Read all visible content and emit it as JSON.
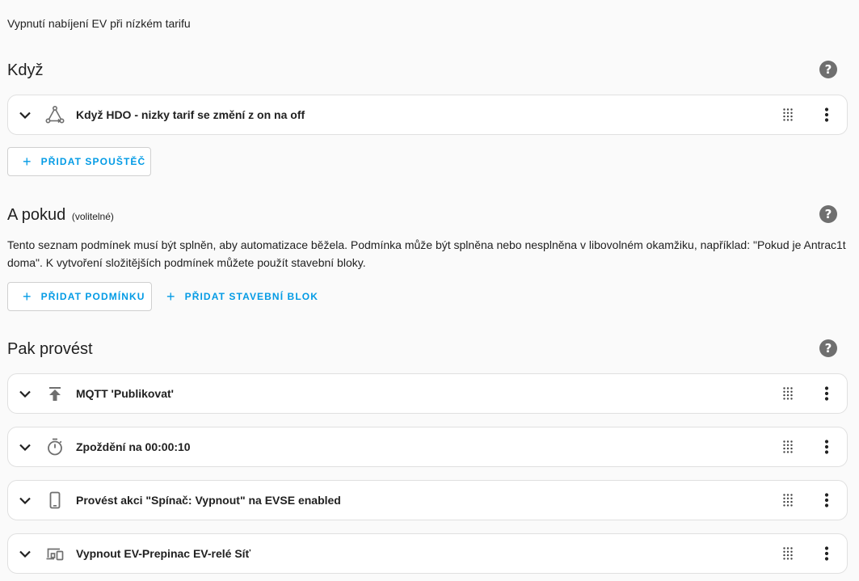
{
  "automation": {
    "description": "Vypnutí nabíjení EV při nízkém tarifu"
  },
  "sections": {
    "triggers": {
      "title": "Když",
      "items": [
        {
          "label": "Když HDO - nizky tarif se změní z on na off",
          "icon": "state-trigger-icon"
        }
      ],
      "add_label": "PŘIDAT SPOUŠTĚČ"
    },
    "conditions": {
      "title": "A pokud",
      "optional": "(volitelné)",
      "description": "Tento seznam podmínek musí být splněn, aby automatizace běžela. Podmínka může být splněna nebo nesplněna v libovolném okamžiku, například: \"Pokud je Antrac1t doma\". K vytvoření složitějších podmínek můžete použít stavební bloky.",
      "add_condition_label": "PŘIDAT PODMÍNKU",
      "add_block_label": "PŘIDAT STAVEBNÍ BLOK"
    },
    "actions": {
      "title": "Pak provést",
      "items": [
        {
          "label": "MQTT 'Publikovat'",
          "icon": "publish-icon"
        },
        {
          "label": "Zpoždění na 00:00:10",
          "icon": "timer-icon"
        },
        {
          "label": "Provést akci \"Spínač: Vypnout\" na EVSE enabled",
          "icon": "phone-device-icon"
        },
        {
          "label": "Vypnout EV-Prepinac EV-relé Síť",
          "icon": "devices-icon"
        }
      ]
    }
  },
  "icons": {
    "help": "?",
    "plus": "+"
  },
  "colors": {
    "accent": "#039be5",
    "icon_gray": "#6f6f6f",
    "background": "#fafafa",
    "card_border": "#e0e0e0"
  }
}
